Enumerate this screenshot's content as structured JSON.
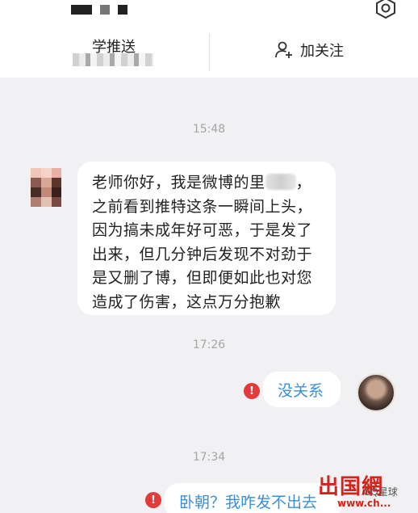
{
  "header": {
    "tabs": [
      {
        "label": "学推送"
      }
    ],
    "follow_label": "加关注"
  },
  "messages": {
    "t1": "15:48",
    "incoming_text_1": "老师你好，我是微博的里",
    "incoming_text_2": "，之前看到推特这条一瞬间上头，因为搞未成年好可恶，于是发了出来，但几分钟后发现不对劲于是又删了博，但即便如此也对您造成了伤害，这点万分抱歉",
    "t2": "17:26",
    "outgoing_1": "没关系",
    "t3": "17:34",
    "outgoing_2": "卧朝？我咋发不出去",
    "error_mark": "!"
  },
  "watermark": {
    "logo": "出国網",
    "account": "GQ星球",
    "url": "www.ch..."
  },
  "icons": {
    "settings": "gear-icon",
    "follow": "add-user-icon",
    "error": "error-icon"
  }
}
